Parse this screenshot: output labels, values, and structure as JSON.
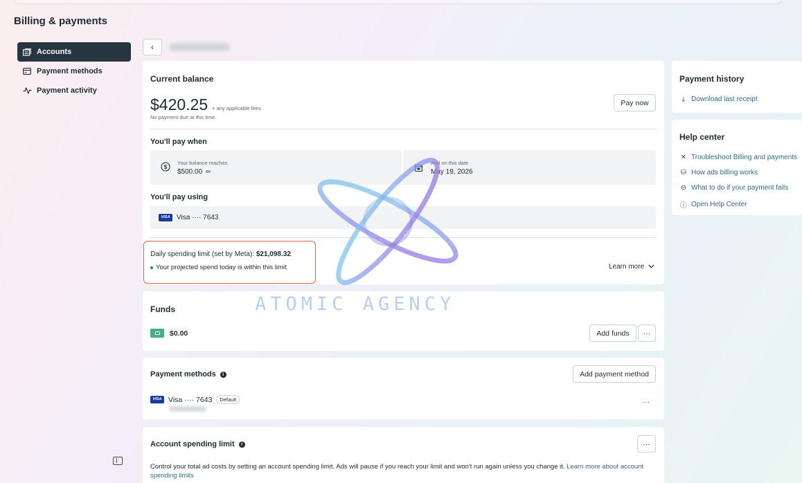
{
  "page": {
    "title": "Billing & payments"
  },
  "sidebar": {
    "items": [
      {
        "label": "Accounts",
        "icon": "accounts-icon",
        "active": true
      },
      {
        "label": "Payment methods",
        "icon": "card-icon",
        "active": false
      },
      {
        "label": "Payment activity",
        "icon": "activity-icon",
        "active": false
      }
    ]
  },
  "balance": {
    "title": "Current balance",
    "amount": "$420.25",
    "fees_note": "+ any applicable fees",
    "due_note": "No payment due at this time.",
    "pay_now": "Pay now",
    "pay_when_title": "You'll pay when",
    "threshold_label": "Your balance reaches",
    "threshold_value": "$500.00",
    "date_label": "And on this date",
    "date_value": "May 19, 2026",
    "pay_using_title": "You'll pay using",
    "card_brand": "VISA",
    "card_label": "Visa ···· 7643",
    "daily_limit_label": "Daily spending limit (set by Meta):",
    "daily_limit_value": "$21,098.32",
    "daily_limit_note": "Your projected spend today is within this limit",
    "learn_more": "Learn more"
  },
  "funds": {
    "title": "Funds",
    "amount": "$0.00",
    "add_funds": "Add funds",
    "more": "···"
  },
  "payment_methods": {
    "title": "Payment methods",
    "add_button": "Add payment method",
    "card_brand": "VISA",
    "card_label": "Visa ···· 7643",
    "default_badge": "Default",
    "more": "···"
  },
  "account_limit": {
    "title": "Account spending limit",
    "more": "···",
    "description": "Control your total ad costs by setting an account spending limit. Ads will pause if you reach your limit and won't run again unless you change it.",
    "link": "Learn more about account spending limits"
  },
  "payment_history": {
    "title": "Payment history",
    "download": "Download last receipt"
  },
  "help_center": {
    "title": "Help center",
    "links": [
      {
        "label": "Troubleshoot Billing and payments",
        "icon": "tools-icon"
      },
      {
        "label": "How ads billing works",
        "icon": "coins-icon"
      },
      {
        "label": "What to do if your payment fails",
        "icon": "minus-circle-icon"
      },
      {
        "label": "Open Help Center",
        "icon": "question-icon"
      }
    ]
  },
  "watermark": {
    "text": "ATOMIC AGENCY"
  },
  "colors": {
    "accent_dark": "#263540",
    "link": "#2f6a87",
    "highlight": "#e0664c",
    "status_green": "#1d8a5c",
    "funds_green": "#3fb08a",
    "visa_blue": "#1a3a9e"
  }
}
